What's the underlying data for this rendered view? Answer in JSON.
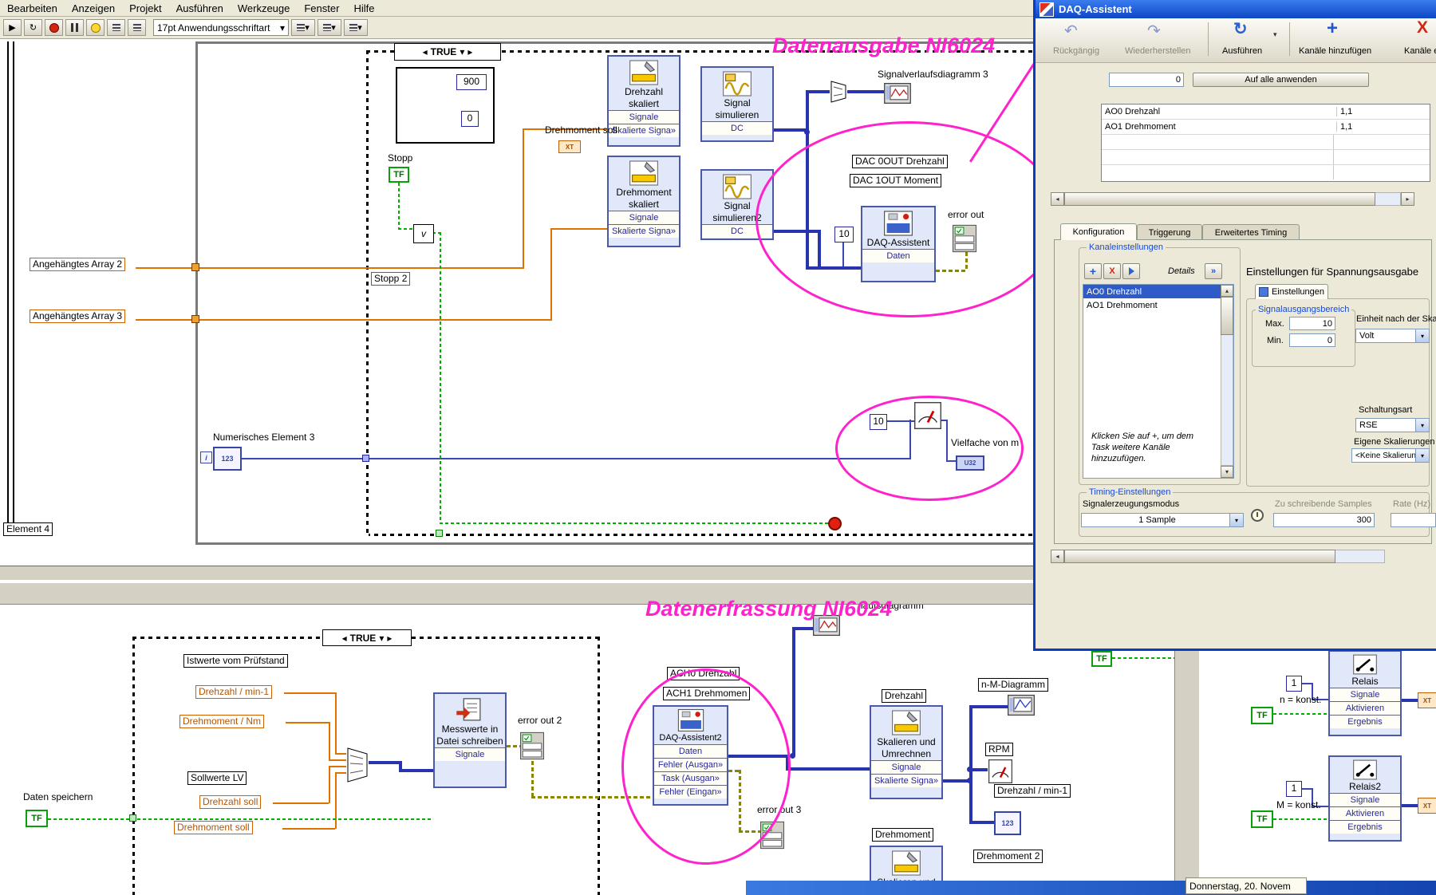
{
  "colors": {
    "magenta": "#ff22cc",
    "orange": "#e07200",
    "wire_blue": "#2833b0",
    "green": "#00b000",
    "titlebar": "#0d47c4",
    "selection": "#2f5bc8"
  },
  "icons": {
    "undo": "↶",
    "redo": "↻",
    "run": "↻",
    "add": "+",
    "remove": "X",
    "dropdown": "▾",
    "left": "◂",
    "right": "▸",
    "up": "▴",
    "down": "▾",
    "chev": "»",
    "check": "✓",
    "play": "▶"
  },
  "menu": {
    "items": [
      "Bearbeiten",
      "Anzeigen",
      "Projekt",
      "Ausführen",
      "Werkzeuge",
      "Fenster",
      "Hilfe"
    ]
  },
  "toolbar": {
    "font": "17pt Anwendungsschriftart"
  },
  "top": {
    "annotation": "Datenausgabe NI6024",
    "case_sel": "TRUE",
    "c900": "900",
    "c0": "0",
    "c10": "10",
    "stopp": "Stopp",
    "stopp2": "Stopp 2",
    "tf": "TF",
    "or_glyph": "v",
    "arr2": "Angehängtes Array 2",
    "arr3": "Angehängtes Array 3",
    "drehmoment_soll": "Drehmoment soll",
    "xt": "XT",
    "vi_drz": {
      "name": "Drehzahl skaliert",
      "r1": "Signale",
      "r2": "Skalierte Signa»"
    },
    "vi_sim": {
      "name": "Signal simulieren",
      "r1": "DC"
    },
    "vi_drm": {
      "name": "Drehmoment skaliert",
      "r1": "Signale",
      "r2": "Skalierte Signa»"
    },
    "vi_sim2": {
      "name": "Signal simulieren2",
      "r1": "DC"
    },
    "chart_label": "Signalverlaufsdiagramm 3",
    "dac0": "DAC 0OUT Drehzahl",
    "dac1": "DAC 1OUT Moment",
    "daq_name": "DAQ-Assistent",
    "daq_r1": "Daten",
    "error_out": "error out",
    "num_label": "Numerisches Element 3",
    "i_glyph": "i",
    "n123": "123",
    "vielfache": "Vielfache von m",
    "u32": "U32",
    "elem4": "Element 4"
  },
  "bottom": {
    "annotation": "Datenerfrassung NI6024",
    "case_sel": "TRUE",
    "istwerte": "Istwerte vom Prüfstand",
    "drz_min": "Drehzahl / min-1",
    "drm_nm": "Drehmoment / Nm",
    "sollwerte": "Sollwerte LV",
    "drz_soll": "Drehzahl soll",
    "drm_soll": "Drehmoment soll",
    "daten_speichern": "Daten speichern",
    "tf": "TF",
    "vi_mess": {
      "name": "Messwerte in Datei schreiben",
      "r1": "Signale"
    },
    "error_out2": "error out 2",
    "error_out3": "error out 3",
    "ach0": "ACH0 Drehzahl",
    "ach1": "ACH1 Drehmomen",
    "vi_daq2": {
      "name": "DAQ-Assistent2",
      "r1": "Daten",
      "r2": "Fehler (Ausgan»",
      "r3": "Task (Ausgan»",
      "r4": "Fehler (Eingan»"
    },
    "drehzahl": "Drehzahl",
    "vi_skal": {
      "name": "Skalieren und Umrechnen",
      "r1": "Signale",
      "r2": "Skalierte Signa»"
    },
    "nm_diagramm": "n-M-Diagramm",
    "rpm": "RPM",
    "drz_min2": "Drehzahl / min-1",
    "n123": "123",
    "drehmoment": "Drehmoment",
    "drehmoment2": "Drehmoment 2",
    "laufsdiagramm": "laufsdiagramm"
  },
  "right": {
    "vi_relais": {
      "name": "Relais",
      "r1": "Signale",
      "r2": "Aktivieren",
      "r3": "Ergebnis"
    },
    "vi_relais2": {
      "name": "Relais2",
      "r1": "Signale",
      "r2": "Aktivieren",
      "r3": "Ergebnis"
    },
    "c1a": "1",
    "c1b": "1",
    "n_konst": "n = konst.",
    "m_konst": "M = konst.",
    "tf": "TF",
    "tf_top": "TF",
    "xt": "XT"
  },
  "statusbar": {
    "date": "Donnerstag, 20. Novem"
  },
  "dialog": {
    "title": "DAQ-Assistent",
    "toolbar": {
      "undo": "Rückgängig",
      "redo": "Wiederherstellen",
      "run": "Ausführen",
      "add": "Kanäle hinzufügen",
      "remove": "Kanäle ent"
    },
    "apply_value": "0",
    "apply_button": "Auf alle anwenden",
    "table": {
      "rows": [
        [
          "AO0 Drehzahl",
          "1,1"
        ],
        [
          "AO1 Drehmoment",
          "1,1"
        ]
      ]
    },
    "tabs": [
      "Konfiguration",
      "Triggerung",
      "Erweitertes Timing"
    ],
    "channel_group": "Kanaleinstellungen",
    "details": "Details",
    "channels": [
      "AO0 Drehzahl",
      "AO1 Drehmoment"
    ],
    "hint": "Klicken Sie auf +, um dem Task weitere Kanäle hinzuzufügen.",
    "right_title": "Einstellungen für Spannungsausgabe",
    "settings_tab": "Einstellungen",
    "range_group": "Signalausgangsbereich",
    "max_label": "Max.",
    "max_value": "10",
    "min_label": "Min.",
    "min_value": "0",
    "unit_label": "Einheit nach der Ska",
    "unit_value": "Volt",
    "circuit_label": "Schaltungsart",
    "circuit_value": "RSE",
    "scaling_label": "Eigene Skalierungen",
    "scaling_value": "<Keine Skalierung>",
    "timing_group": "Timing-Einstellungen",
    "mode_label": "Signalerzeugungsmodus",
    "mode_value": "1 Sample",
    "samples_label": "Zu schreibende Samples",
    "samples_value": "300",
    "rate_label": "Rate (Hz)"
  }
}
